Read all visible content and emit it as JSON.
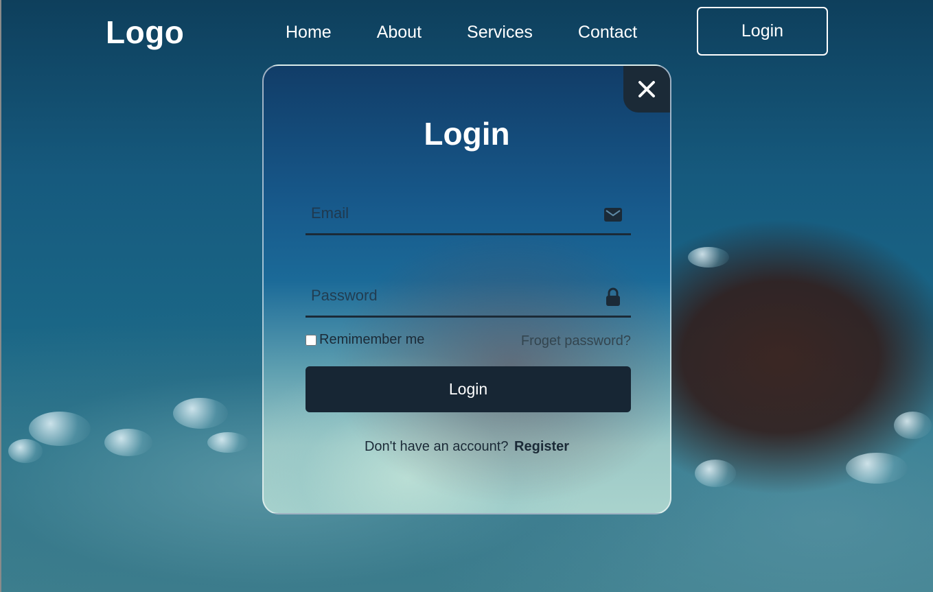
{
  "header": {
    "logo": "Logo",
    "nav": [
      "Home",
      "About",
      "Services",
      "Contact"
    ],
    "login_button": "Login"
  },
  "modal": {
    "title": "Login",
    "email_placeholder": "Email",
    "password_placeholder": "Password",
    "remember_label": "Remimember me",
    "forgot_link": "Froget password?",
    "submit_label": "Login",
    "register_prompt": "Don't have an account?",
    "register_link": "Register",
    "icons": {
      "close": "close-icon",
      "email": "mail-icon",
      "password": "lock-icon"
    }
  },
  "colors": {
    "accent_dark": "#172634",
    "text_light": "#ffffff"
  }
}
